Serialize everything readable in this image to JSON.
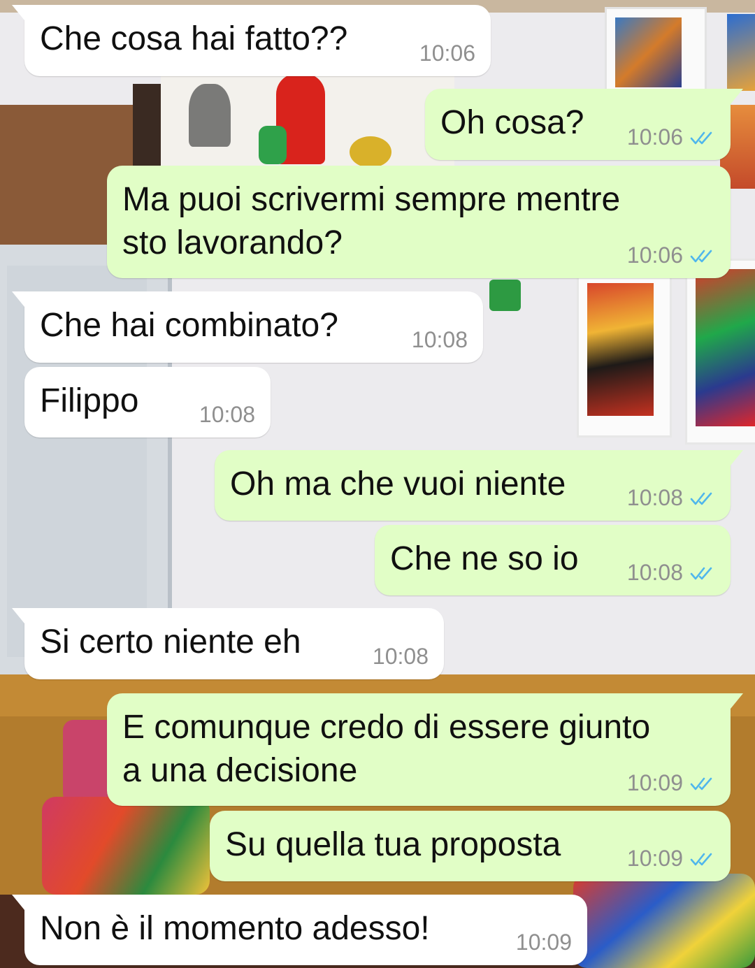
{
  "messages": [
    {
      "direction": "incoming",
      "text": "Che cosa hai fatto??",
      "time": "10:06"
    },
    {
      "direction": "outgoing",
      "text": "Oh cosa?",
      "time": "10:06",
      "status": "read"
    },
    {
      "direction": "outgoing",
      "text": "Ma puoi scrivermi sempre mentre\nsto lavorando?",
      "time": "10:06",
      "status": "read"
    },
    {
      "direction": "incoming",
      "text": "Che hai combinato?",
      "time": "10:08"
    },
    {
      "direction": "incoming",
      "text": "Filippo",
      "time": "10:08"
    },
    {
      "direction": "outgoing",
      "text": "Oh ma che vuoi niente",
      "time": "10:08",
      "status": "read"
    },
    {
      "direction": "outgoing",
      "text": "Che ne so io",
      "time": "10:08",
      "status": "read"
    },
    {
      "direction": "incoming",
      "text": "Si certo niente eh",
      "time": "10:08"
    },
    {
      "direction": "outgoing",
      "text": "E comunque credo di essere giunto\na una decisione",
      "time": "10:09",
      "status": "read"
    },
    {
      "direction": "outgoing",
      "text": "Su quella tua proposta",
      "time": "10:09",
      "status": "read"
    },
    {
      "direction": "incoming",
      "text": "Non è il momento adesso!",
      "time": "10:09"
    }
  ],
  "colors": {
    "incoming_bubble": "#ffffff",
    "outgoing_bubble": "#e1fec6",
    "timestamp": "#8f8f8f",
    "read_ticks": "#4fb6ec"
  }
}
